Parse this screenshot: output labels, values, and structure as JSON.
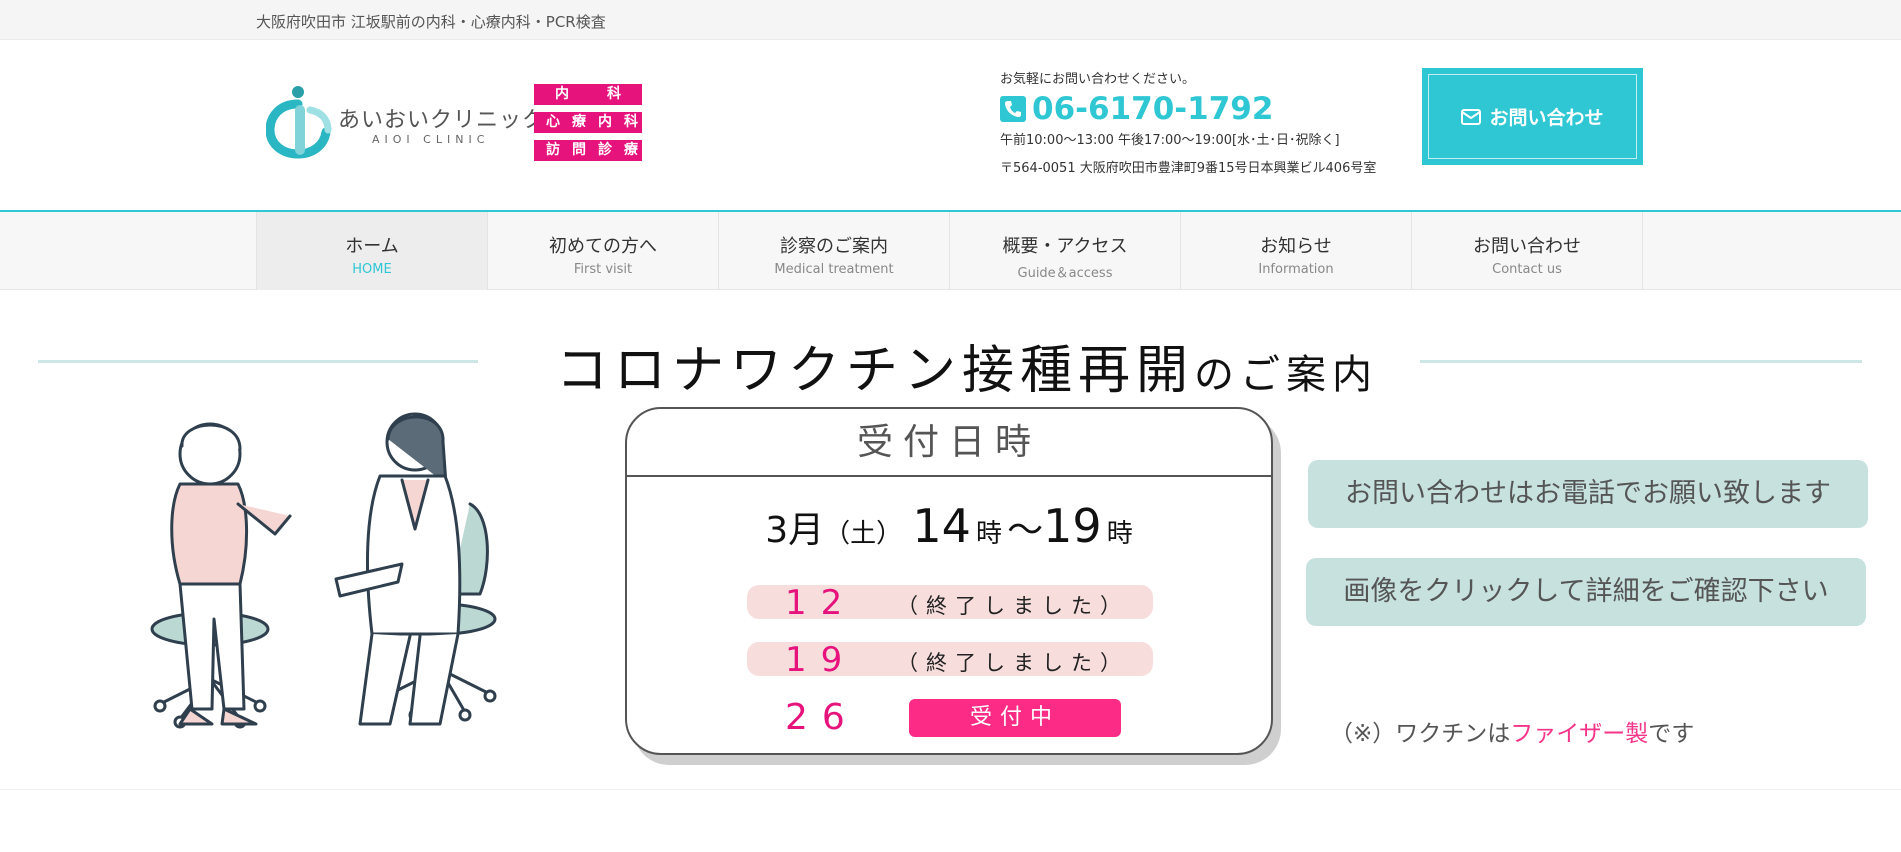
{
  "topbar": {
    "text": "大阪府吹田市 江坂駅前の内科・心療内科・PCR検査"
  },
  "header": {
    "logo_jp": "あいおいクリニック",
    "logo_en": "AIOI CLINIC",
    "tags": [
      "内　科",
      "心療内科",
      "訪問診療"
    ],
    "contact_lead": "お気軽にお問い合わせください。",
    "phone": "06-6170-1792",
    "hours": "午前10:00〜13:00 午後17:00〜19:00[水･土･日･祝除く]",
    "address": "〒564-0051 大阪府吹田市豊津町9番15号日本興業ビル406号室",
    "contact_button": "お問い合わせ",
    "accent_color": "#2ec7d3",
    "tag_color": "#e6137d"
  },
  "nav": {
    "items": [
      {
        "jp": "ホーム",
        "en": "HOME"
      },
      {
        "jp": "初めての方へ",
        "en": "First visit"
      },
      {
        "jp": "診察のご案内",
        "en": "Medical treatment"
      },
      {
        "jp": "概要・アクセス",
        "en": "Guide＆access"
      },
      {
        "jp": "お知らせ",
        "en": "Information"
      },
      {
        "jp": "お問い合わせ",
        "en": "Contact us"
      }
    ]
  },
  "banner": {
    "title_main": "コロナワクチン接種再開",
    "title_sub": "のご案内",
    "card_head": "受付日時",
    "date_month": "3月",
    "date_day": "（土）",
    "time_start": "14",
    "time_unit": "時",
    "time_sep": "〜",
    "time_end": "19",
    "slots": [
      {
        "day": "12",
        "status": "（終了しました）"
      },
      {
        "day": "19",
        "status": "（終了しました）"
      },
      {
        "day": "26",
        "status": "受付中"
      }
    ],
    "pill_phone": "お問い合わせはお電話でお願い致します",
    "pill_click": "画像をクリックして詳細をご確認下さい",
    "note_prefix": "（※）ワクチンは",
    "note_highlight": "ファイザー製",
    "note_suffix": "です"
  }
}
